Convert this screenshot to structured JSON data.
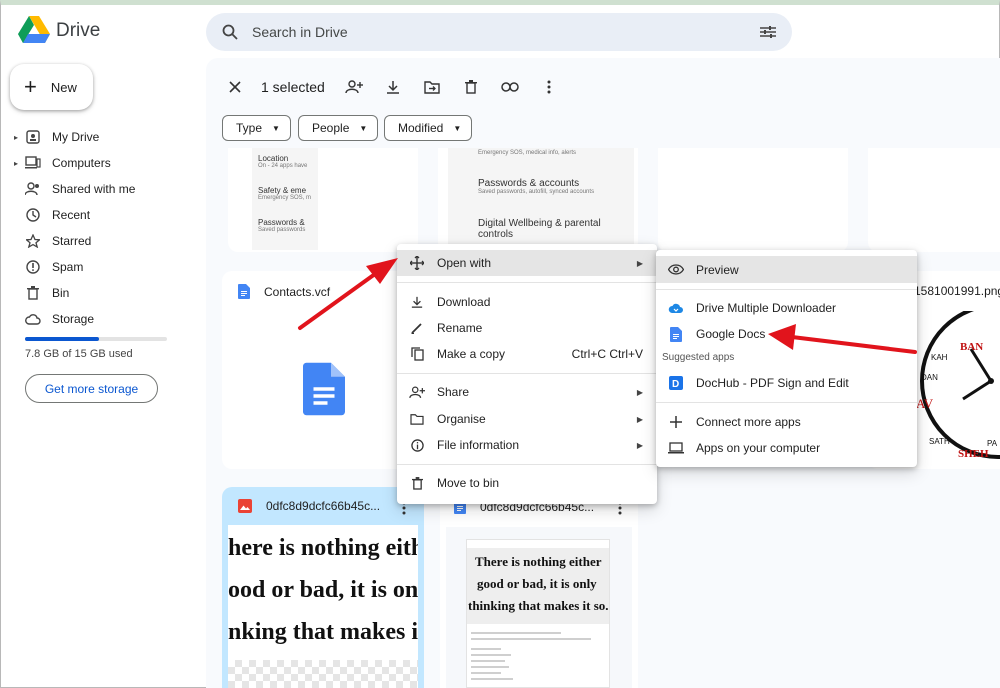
{
  "app": {
    "name": "Drive"
  },
  "new_button": {
    "label": "New"
  },
  "nav": [
    {
      "label": "My Drive",
      "icon": "my-drive-icon"
    },
    {
      "label": "Computers",
      "icon": "computers-icon"
    },
    {
      "label": "Shared with me",
      "icon": "shared-icon"
    },
    {
      "label": "Recent",
      "icon": "clock-icon"
    },
    {
      "label": "Starred",
      "icon": "star-icon"
    },
    {
      "label": "Spam",
      "icon": "spam-icon"
    },
    {
      "label": "Bin",
      "icon": "trash-icon"
    },
    {
      "label": "Storage",
      "icon": "cloud-icon"
    }
  ],
  "storage": {
    "used_text": "7.8 GB of 15 GB used",
    "used_fraction": 0.52,
    "button": "Get more storage"
  },
  "search": {
    "placeholder": "Search in Drive"
  },
  "toolbar": {
    "selected_text": "1 selected"
  },
  "filters": [
    {
      "label": "Type"
    },
    {
      "label": "People"
    },
    {
      "label": "Modified"
    }
  ],
  "thumb1": {
    "rows": [
      {
        "title": "Location",
        "sub": "On - 24 apps have"
      },
      {
        "title": "Safety & eme",
        "sub": "Emergency SOS, m"
      },
      {
        "title": "Passwords &",
        "sub": "Saved passwords"
      }
    ]
  },
  "thumb2": {
    "top_sub": "Emergency SOS, medical info, alerts",
    "rows": [
      {
        "title": "Passwords & accounts",
        "sub": "Saved passwords, autofill, synced accounts"
      },
      {
        "title": "Digital Wellbeing & parental",
        "sub": "controls"
      }
    ]
  },
  "files": {
    "contacts": "Contacts.vcf",
    "right_file": "1581001991.png",
    "image_file": "0dfc8d9dcfc66b45c...",
    "doc_file": "0dfc8d9dcfc66b45c..."
  },
  "clock_labels": [
    "BAN",
    "KAH",
    "DAN",
    "AV",
    "SATH",
    "SHEH",
    "PA"
  ],
  "quote_lines_big": [
    "here is nothing eith",
    "ood or bad, it is on",
    "nking that makes i"
  ],
  "quote_lines_doc": [
    "There is nothing either",
    "good or bad, it is only",
    "thinking that makes it so."
  ],
  "context_menu": {
    "open_with": "Open with",
    "download": "Download",
    "rename": "Rename",
    "make_copy": "Make a copy",
    "make_copy_shortcut": "Ctrl+C Ctrl+V",
    "share": "Share",
    "organise": "Organise",
    "file_information": "File information",
    "move_to_bin": "Move to bin"
  },
  "open_with_menu": {
    "preview": "Preview",
    "app1": "Drive Multiple Downloader",
    "app2": "Google Docs",
    "suggested_label": "Suggested apps",
    "app3": "DocHub - PDF Sign and Edit",
    "connect": "Connect more apps",
    "computer_apps": "Apps on your computer"
  },
  "colors": {
    "accent": "#0b57d0",
    "arrow": "#e1141c",
    "docs_blue": "#4285f4",
    "selected_card": "#c2e7ff"
  }
}
